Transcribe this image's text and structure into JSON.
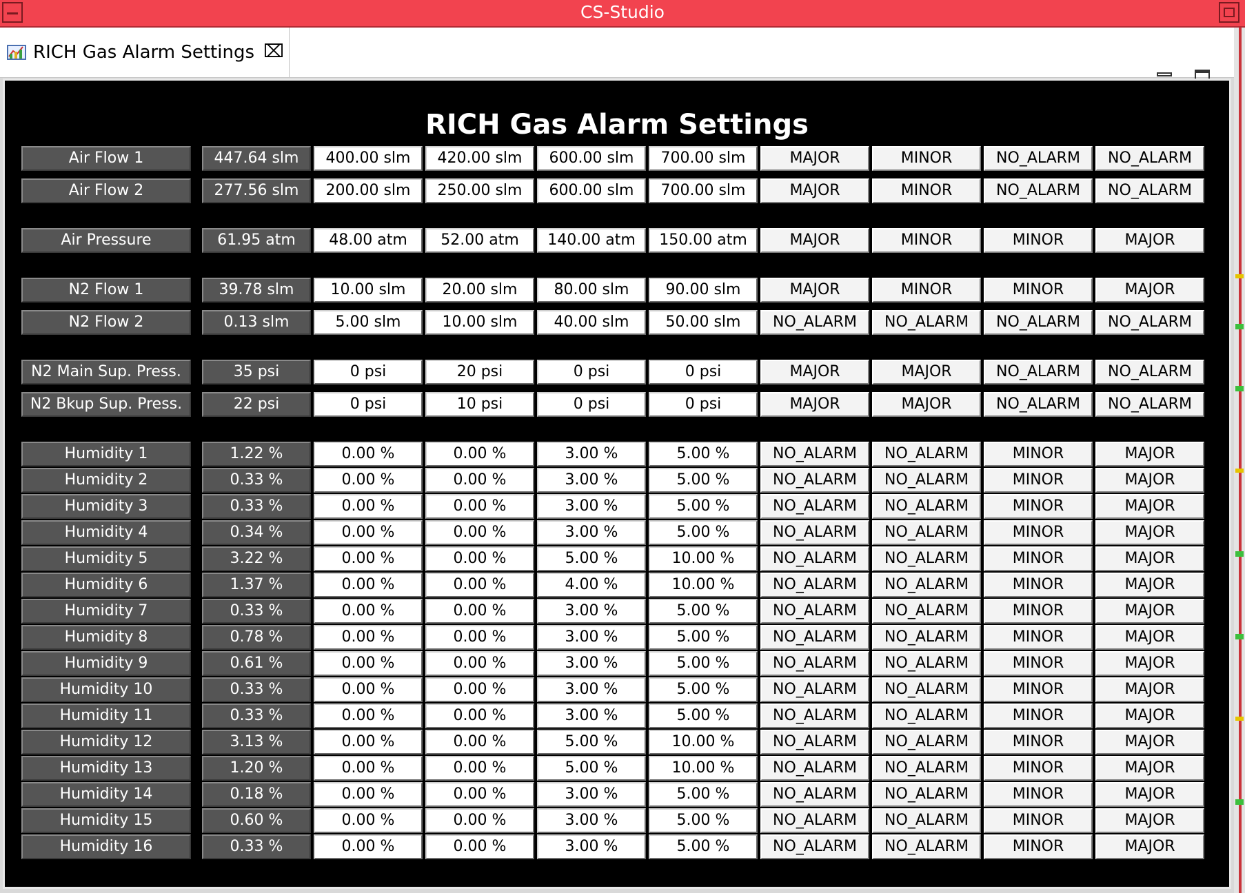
{
  "window": {
    "title": "CS-Studio"
  },
  "tab": {
    "label": "RICH Gas Alarm Settings",
    "close_glyph": "⌧",
    "icon": "chart-icon"
  },
  "panel": {
    "title": "RICH Gas Alarm Settings"
  },
  "rows": [
    {
      "name": "Air Flow 1",
      "value": "447.64 slm",
      "limits": [
        "400.00 slm",
        "420.00 slm",
        "600.00 slm",
        "700.00 slm"
      ],
      "severities": [
        "MAJOR",
        "MINOR",
        "NO_ALARM",
        "NO_ALARM"
      ]
    },
    {
      "name": "Air Flow 2",
      "value": "277.56 slm",
      "limits": [
        "200.00 slm",
        "250.00 slm",
        "600.00 slm",
        "700.00 slm"
      ],
      "severities": [
        "MAJOR",
        "MINOR",
        "NO_ALARM",
        "NO_ALARM"
      ]
    },
    {
      "name": "Air Pressure",
      "value": "61.95 atm",
      "limits": [
        "48.00 atm",
        "52.00 atm",
        "140.00 atm",
        "150.00 atm"
      ],
      "severities": [
        "MAJOR",
        "MINOR",
        "MINOR",
        "MAJOR"
      ]
    },
    {
      "name": "N2 Flow 1",
      "value": "39.78 slm",
      "limits": [
        "10.00 slm",
        "20.00 slm",
        "80.00 slm",
        "90.00 slm"
      ],
      "severities": [
        "MAJOR",
        "MINOR",
        "MINOR",
        "MAJOR"
      ]
    },
    {
      "name": "N2 Flow 2",
      "value": "0.13 slm",
      "limits": [
        "5.00 slm",
        "10.00 slm",
        "40.00 slm",
        "50.00 slm"
      ],
      "severities": [
        "NO_ALARM",
        "NO_ALARM",
        "NO_ALARM",
        "NO_ALARM"
      ]
    },
    {
      "name": "N2 Main Sup. Press.",
      "value": "35 psi",
      "limits": [
        "0 psi",
        "20 psi",
        "0 psi",
        "0 psi"
      ],
      "severities": [
        "MAJOR",
        "MAJOR",
        "NO_ALARM",
        "NO_ALARM"
      ]
    },
    {
      "name": "N2 Bkup Sup. Press.",
      "value": "22 psi",
      "limits": [
        "0 psi",
        "10 psi",
        "0 psi",
        "0 psi"
      ],
      "severities": [
        "MAJOR",
        "MAJOR",
        "NO_ALARM",
        "NO_ALARM"
      ]
    },
    {
      "name": "Humidity 1",
      "value": "1.22 %",
      "limits": [
        "0.00 %",
        "0.00 %",
        "3.00 %",
        "5.00 %"
      ],
      "severities": [
        "NO_ALARM",
        "NO_ALARM",
        "MINOR",
        "MAJOR"
      ]
    },
    {
      "name": "Humidity 2",
      "value": "0.33 %",
      "limits": [
        "0.00 %",
        "0.00 %",
        "3.00 %",
        "5.00 %"
      ],
      "severities": [
        "NO_ALARM",
        "NO_ALARM",
        "MINOR",
        "MAJOR"
      ]
    },
    {
      "name": "Humidity 3",
      "value": "0.33 %",
      "limits": [
        "0.00 %",
        "0.00 %",
        "3.00 %",
        "5.00 %"
      ],
      "severities": [
        "NO_ALARM",
        "NO_ALARM",
        "MINOR",
        "MAJOR"
      ]
    },
    {
      "name": "Humidity 4",
      "value": "0.34 %",
      "limits": [
        "0.00 %",
        "0.00 %",
        "3.00 %",
        "5.00 %"
      ],
      "severities": [
        "NO_ALARM",
        "NO_ALARM",
        "MINOR",
        "MAJOR"
      ]
    },
    {
      "name": "Humidity 5",
      "value": "3.22 %",
      "limits": [
        "0.00 %",
        "0.00 %",
        "5.00 %",
        "10.00 %"
      ],
      "severities": [
        "NO_ALARM",
        "NO_ALARM",
        "MINOR",
        "MAJOR"
      ]
    },
    {
      "name": "Humidity 6",
      "value": "1.37 %",
      "limits": [
        "0.00 %",
        "0.00 %",
        "4.00 %",
        "10.00 %"
      ],
      "severities": [
        "NO_ALARM",
        "NO_ALARM",
        "MINOR",
        "MAJOR"
      ]
    },
    {
      "name": "Humidity 7",
      "value": "0.33 %",
      "limits": [
        "0.00 %",
        "0.00 %",
        "3.00 %",
        "5.00 %"
      ],
      "severities": [
        "NO_ALARM",
        "NO_ALARM",
        "MINOR",
        "MAJOR"
      ]
    },
    {
      "name": "Humidity 8",
      "value": "0.78 %",
      "limits": [
        "0.00 %",
        "0.00 %",
        "3.00 %",
        "5.00 %"
      ],
      "severities": [
        "NO_ALARM",
        "NO_ALARM",
        "MINOR",
        "MAJOR"
      ]
    },
    {
      "name": "Humidity 9",
      "value": "0.61 %",
      "limits": [
        "0.00 %",
        "0.00 %",
        "3.00 %",
        "5.00 %"
      ],
      "severities": [
        "NO_ALARM",
        "NO_ALARM",
        "MINOR",
        "MAJOR"
      ]
    },
    {
      "name": "Humidity 10",
      "value": "0.33 %",
      "limits": [
        "0.00 %",
        "0.00 %",
        "3.00 %",
        "5.00 %"
      ],
      "severities": [
        "NO_ALARM",
        "NO_ALARM",
        "MINOR",
        "MAJOR"
      ]
    },
    {
      "name": "Humidity 11",
      "value": "0.33 %",
      "limits": [
        "0.00 %",
        "0.00 %",
        "3.00 %",
        "5.00 %"
      ],
      "severities": [
        "NO_ALARM",
        "NO_ALARM",
        "MINOR",
        "MAJOR"
      ]
    },
    {
      "name": "Humidity 12",
      "value": "3.13 %",
      "limits": [
        "0.00 %",
        "0.00 %",
        "5.00 %",
        "10.00 %"
      ],
      "severities": [
        "NO_ALARM",
        "NO_ALARM",
        "MINOR",
        "MAJOR"
      ]
    },
    {
      "name": "Humidity 13",
      "value": "1.20 %",
      "limits": [
        "0.00 %",
        "0.00 %",
        "5.00 %",
        "10.00 %"
      ],
      "severities": [
        "NO_ALARM",
        "NO_ALARM",
        "MINOR",
        "MAJOR"
      ]
    },
    {
      "name": "Humidity 14",
      "value": "0.18 %",
      "limits": [
        "0.00 %",
        "0.00 %",
        "3.00 %",
        "5.00 %"
      ],
      "severities": [
        "NO_ALARM",
        "NO_ALARM",
        "MINOR",
        "MAJOR"
      ]
    },
    {
      "name": "Humidity 15",
      "value": "0.60 %",
      "limits": [
        "0.00 %",
        "0.00 %",
        "3.00 %",
        "5.00 %"
      ],
      "severities": [
        "NO_ALARM",
        "NO_ALARM",
        "MINOR",
        "MAJOR"
      ]
    },
    {
      "name": "Humidity 16",
      "value": "0.33 %",
      "limits": [
        "0.00 %",
        "0.00 %",
        "3.00 %",
        "5.00 %"
      ],
      "severities": [
        "NO_ALARM",
        "NO_ALARM",
        "MINOR",
        "MAJOR"
      ]
    }
  ]
}
